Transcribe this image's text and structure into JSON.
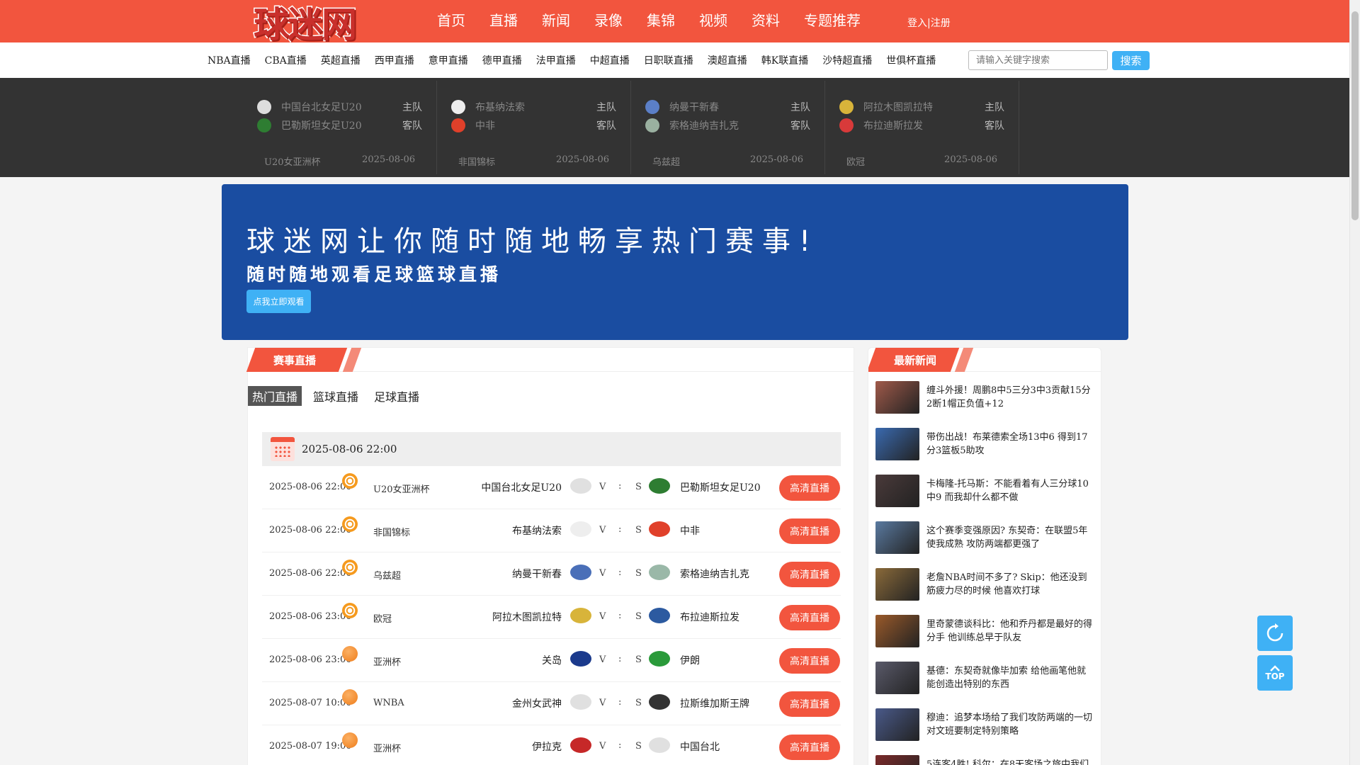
{
  "header": {
    "logo_text": "球迷网",
    "nav": [
      "首页",
      "直播",
      "新闻",
      "录像",
      "集锦",
      "视频",
      "资料",
      "专题推荐"
    ],
    "login": "登入|注册"
  },
  "subnav": {
    "links": [
      "NBA直播",
      "CBA直播",
      "英超直播",
      "西甲直播",
      "意甲直播",
      "德甲直播",
      "法甲直播",
      "中超直播",
      "日职联直播",
      "澳超直播",
      "韩K联直播",
      "沙特超直播",
      "世俱杯直播"
    ],
    "search_placeholder": "请输入关键字搜索",
    "search_button": "搜索"
  },
  "strip": {
    "home_role": "主队",
    "away_role": "客队",
    "cards": [
      {
        "home": "中国台北女足U20",
        "away": "巴勒斯坦女足U20",
        "league": "U20女亚洲杯",
        "date": "2025-08-06",
        "home_color": "#dddddd",
        "away_color": "#2e7d32"
      },
      {
        "home": "布基纳法索",
        "away": "中非",
        "league": "非国锦标",
        "date": "2025-08-06",
        "home_color": "#eeeeee",
        "away_color": "#e0402a"
      },
      {
        "home": "纳曼干新春",
        "away": "索格迪纳吉扎克",
        "league": "乌兹超",
        "date": "2025-08-06",
        "home_color": "#5b7fc7",
        "away_color": "#9ab0a0"
      },
      {
        "home": "阿拉木图凯拉特",
        "away": "布拉迪斯拉发",
        "league": "欧冠",
        "date": "2025-08-06",
        "home_color": "#d8b43a",
        "away_color": "#d83a3a"
      }
    ]
  },
  "banner": {
    "headline": "球迷网让你随时随地畅享热门赛事!",
    "subline": "随时随地观看足球篮球直播",
    "button": "点我立即观看"
  },
  "live": {
    "title": "赛事直播",
    "tabs": [
      "热门直播",
      "篮球直播",
      "足球直播"
    ],
    "active_tab": 0,
    "date_header": "2025-08-06 22:00",
    "vs_v": "V",
    "vs_colon": ":",
    "vs_s": "S",
    "button_label": "高清直播",
    "matches": [
      {
        "time": "2025-08-06 22:00",
        "sport": "football",
        "league": "U20女亚洲杯",
        "home": "中国台北女足U20",
        "away": "巴勒斯坦女足U20",
        "home_color": "#e0e0e0",
        "away_color": "#2e7d32"
      },
      {
        "time": "2025-08-06 22:00",
        "sport": "football",
        "league": "非国锦标",
        "home": "布基纳法索",
        "away": "中非",
        "home_color": "#eeeeee",
        "away_color": "#e0402a"
      },
      {
        "time": "2025-08-06 22:00",
        "sport": "football",
        "league": "乌兹超",
        "home": "纳曼干新春",
        "away": "索格迪纳吉扎克",
        "home_color": "#4a6fb8",
        "away_color": "#9ab8a8"
      },
      {
        "time": "2025-08-06 23:00",
        "sport": "football",
        "league": "欧冠",
        "home": "阿拉木图凯拉特",
        "away": "布拉迪斯拉发",
        "home_color": "#d8b43a",
        "away_color": "#2c5aa0"
      },
      {
        "time": "2025-08-06 23:00",
        "sport": "basketball",
        "league": "亚洲杯",
        "home": "关岛",
        "away": "伊朗",
        "home_color": "#1b3a8c",
        "away_color": "#2a9a3a"
      },
      {
        "time": "2025-08-07 10:00",
        "sport": "basketball",
        "league": "WNBA",
        "home": "金州女武神",
        "away": "拉斯维加斯王牌",
        "home_color": "#e0e0e0",
        "away_color": "#333333"
      },
      {
        "time": "2025-08-07 19:00",
        "sport": "basketball",
        "league": "亚洲杯",
        "home": "伊拉克",
        "away": "中国台北",
        "home_color": "#c62828",
        "away_color": "#e0e0e0"
      }
    ]
  },
  "news": {
    "title": "最新新闻",
    "items": [
      {
        "text": "缠斗外援！周鹏8中5三分3中3贡献15分2断1帽正负值+12",
        "color": "#a05a4a"
      },
      {
        "text": "带伤出战！布莱德索全场13中6 得到17分3篮板5助攻",
        "color": "#3a6ab0"
      },
      {
        "text": "卡梅隆-托马斯：不能看着有人三分球10中9 而我却什么都不做",
        "color": "#4a3a3a"
      },
      {
        "text": "这个赛季变强原因? 东契奇：在联盟5年使我成熟 攻防两端都更强了",
        "color": "#5a7aa0"
      },
      {
        "text": "老詹NBA时间不多了? Skip：他还没到筋疲力尽的时候 他喜欢打球",
        "color": "#8a6a3a"
      },
      {
        "text": "里奇蒙德谈科比：他和乔丹都是最好的得分手 他训练总早于队友",
        "color": "#9a5a2a"
      },
      {
        "text": "基德：东契奇就像毕加索 给他画笔他就能创造出特别的东西",
        "color": "#5a5a6a"
      },
      {
        "text": "穆迪：追梦本场给了我们攻防两端的一切对文班要制定特别策略",
        "color": "#4a5a8a"
      },
      {
        "text": "5连客4胜! 科尔：在8天客场之旅中我们",
        "color": "#7a2a2a"
      }
    ]
  },
  "float": {
    "top_label": "TOP"
  }
}
